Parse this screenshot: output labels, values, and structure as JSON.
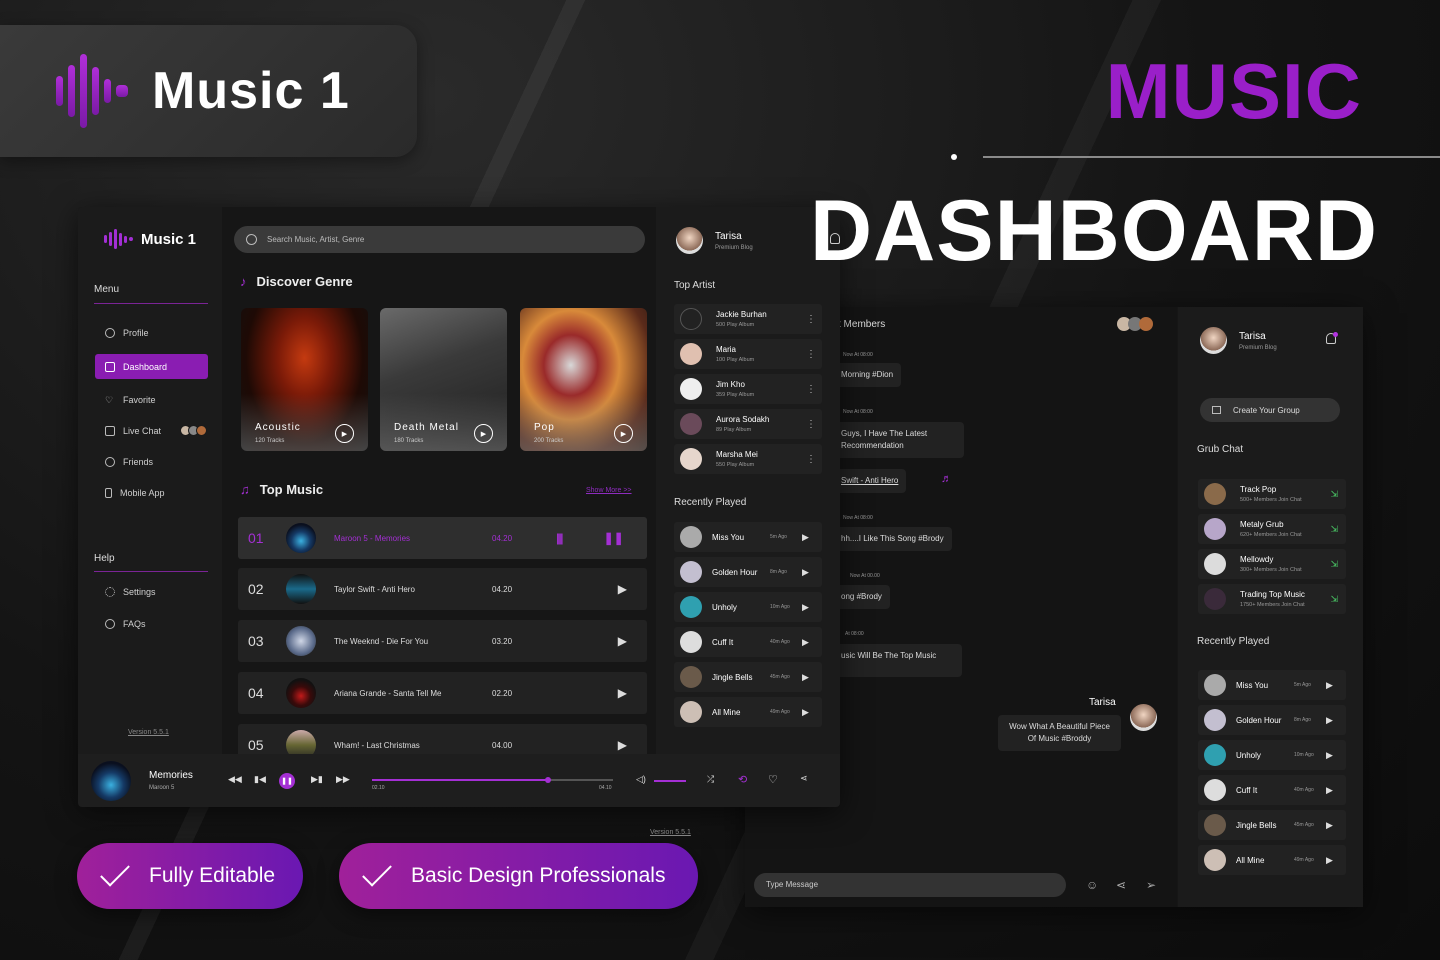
{
  "brand": {
    "name": "Music 1"
  },
  "hero": {
    "title1": "MUSIC",
    "title2": "DASHBOARD"
  },
  "sidebar": {
    "logo": "Music 1",
    "menu_title": "Menu",
    "items": [
      {
        "label": "Profile",
        "icon": "user-icon"
      },
      {
        "label": "Dashboard",
        "icon": "grid-icon",
        "active": true
      },
      {
        "label": "Favorite",
        "icon": "heart-icon"
      },
      {
        "label": "Live Chat",
        "icon": "chat-icon"
      },
      {
        "label": "Friends",
        "icon": "friends-icon"
      },
      {
        "label": "Mobile App",
        "icon": "phone-icon"
      }
    ],
    "help_title": "Help",
    "help_items": [
      {
        "label": "Settings",
        "icon": "gear-icon"
      },
      {
        "label": "FAQs",
        "icon": "faq-icon"
      }
    ],
    "version": "Version 5.5.1"
  },
  "search": {
    "placeholder": "Search Music, Artist, Genre"
  },
  "discover": {
    "title": "Discover Genre",
    "genres": [
      {
        "name": "Acoustic",
        "tracks": "120 Tracks"
      },
      {
        "name": "Death Metal",
        "tracks": "180 Tracks"
      },
      {
        "name": "Pop",
        "tracks": "200 Tracks"
      }
    ]
  },
  "top_music": {
    "title": "Top Music",
    "show_more": "Show More >>",
    "tracks": [
      {
        "no": "01",
        "title": "Maroon 5 - Memories",
        "duration": "04.20",
        "active": true
      },
      {
        "no": "02",
        "title": "Taylor Swift - Anti Hero",
        "duration": "04.20"
      },
      {
        "no": "03",
        "title": "The Weeknd - Die For You",
        "duration": "03.20"
      },
      {
        "no": "04",
        "title": "Ariana Grande - Santa Tell Me",
        "duration": "02.20"
      },
      {
        "no": "05",
        "title": "Wham! - Last Christmas",
        "duration": "04.00"
      }
    ]
  },
  "profile": {
    "name": "Tarisa",
    "plan": "Premium Blog"
  },
  "top_artist": {
    "title": "Top Artist",
    "artists": [
      {
        "name": "Jackie Burhan",
        "albums": "500 Play Album"
      },
      {
        "name": "Maria",
        "albums": "100 Play Album"
      },
      {
        "name": "Jim Kho",
        "albums": "359 Play Album"
      },
      {
        "name": "Aurora Sodakh",
        "albums": "89 Play Album"
      },
      {
        "name": "Marsha Mei",
        "albums": "550 Play Album"
      }
    ]
  },
  "recently_played": {
    "title": "Recently Played",
    "items": [
      {
        "title": "Miss You",
        "time": "5m Ago"
      },
      {
        "title": "Golden Hour",
        "time": "8m Ago"
      },
      {
        "title": "Unholy",
        "time": "10m Ago"
      },
      {
        "title": "Cuff It",
        "time": "40m Ago"
      },
      {
        "title": "Jingle Bells",
        "time": "45m Ago"
      },
      {
        "title": "All Mine",
        "time": "49m Ago"
      }
    ]
  },
  "player": {
    "title": "Memories",
    "artist": "Maroon 5",
    "elapsed": "02.10",
    "total": "04.10",
    "progress": 0.73,
    "volume": 0.7
  },
  "chat": {
    "header": "t Members",
    "messages": [
      {
        "time": "Now At 08:00",
        "text": "Morning #Dion"
      },
      {
        "time": "Now At 08:00",
        "text": "Guys, I Have The Latest Recommendation"
      },
      {
        "text": "Swift - Anti Hero"
      },
      {
        "time": "Now At 08:00",
        "text": "hh....I Like This Song #Brody"
      },
      {
        "time": "Now At 00.00",
        "text": "ong #Brody"
      },
      {
        "time": "At 08:00",
        "text": "usic Will Be The Top Music"
      }
    ],
    "self": {
      "name": "Tarisa",
      "text": "Wow What A Beautiful Piece Of Music #Broddy"
    },
    "input_placeholder": "Type Message",
    "create_group": "Create Your Group",
    "group_title": "Grub Chat",
    "groups": [
      {
        "name": "Track Pop",
        "members": "500+ Members Join Chat"
      },
      {
        "name": "Metaly Grub",
        "members": "620+ Members Join Chat"
      },
      {
        "name": "Mellowdy",
        "members": "300+ Members Join Chat"
      },
      {
        "name": "Trading Top Music",
        "members": "1750+ Members Join Chat"
      }
    ],
    "recent_title": "Recently Played",
    "version": "Version 5.5.1"
  },
  "pills": {
    "p1": "Fully Editable",
    "p2": "Basic Design Professionals"
  },
  "colors": {
    "accent": "#9a1fc9",
    "bg": "#121212"
  }
}
